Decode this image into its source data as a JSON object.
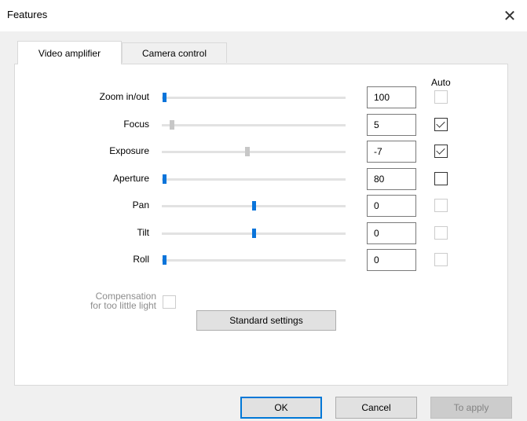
{
  "window": {
    "title": "Features",
    "close_glyph": "✕"
  },
  "tabs": [
    {
      "label": "Video amplifier",
      "active": true
    },
    {
      "label": "Camera control",
      "active": false
    }
  ],
  "panel": {
    "auto_header": "Auto",
    "rows": [
      {
        "label": "Zoom in/out",
        "value": "100",
        "slider_level": 0.0,
        "slider_enabled": true,
        "auto_checked": false,
        "auto_enabled": false
      },
      {
        "label": "Focus",
        "value": "5",
        "slider_level": 0.04,
        "slider_enabled": false,
        "auto_checked": true,
        "auto_enabled": true
      },
      {
        "label": "Exposure",
        "value": "-7",
        "slider_level": 0.46,
        "slider_enabled": false,
        "auto_checked": true,
        "auto_enabled": true
      },
      {
        "label": "Aperture",
        "value": "80",
        "slider_level": 0.0,
        "slider_enabled": true,
        "auto_checked": false,
        "auto_enabled": true
      },
      {
        "label": "Pan",
        "value": "0",
        "slider_level": 0.5,
        "slider_enabled": true,
        "auto_checked": false,
        "auto_enabled": false
      },
      {
        "label": "Tilt",
        "value": "0",
        "slider_level": 0.5,
        "slider_enabled": true,
        "auto_checked": false,
        "auto_enabled": false
      },
      {
        "label": "Roll",
        "value": "0",
        "slider_level": 0.0,
        "slider_enabled": true,
        "auto_checked": false,
        "auto_enabled": false
      }
    ],
    "compensation_line1": "Compensation",
    "compensation_line2": "for too little light",
    "standard_settings": "Standard settings"
  },
  "buttons": {
    "ok": "OK",
    "cancel": "Cancel",
    "apply": "To apply"
  },
  "colors": {
    "accent": "#0a74da",
    "disabled_thumb": "#c7c7c7",
    "default_border": "#0078d7"
  }
}
